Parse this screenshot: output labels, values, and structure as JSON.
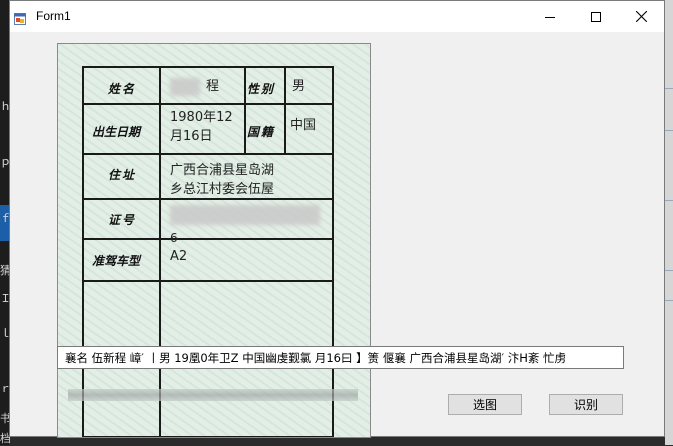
{
  "window": {
    "title": "Form1"
  },
  "id_card": {
    "labels": {
      "name": "姓名",
      "gender": "性别",
      "birth_date": "出生日期",
      "nationality": "国籍",
      "address": "住址",
      "id_number": "证号",
      "vehicle_class": "准驾车型"
    },
    "values": {
      "name_visible_part": "程",
      "gender": "男",
      "birth_date_line1": "1980年12",
      "birth_date_line2": "月16日",
      "nationality": "中国",
      "address_line1": "广西合浦县星岛湖",
      "address_line2": "乡总江村委会伍屋",
      "id_number_tail": "6",
      "vehicle_class": "A2"
    }
  },
  "ocr_result": {
    "value": "襄名 伍新程 嶂′ 丨男 19凰0年卫Z 中国幽虔觐氯 月16曰 】箦   偃襄 广西合浦县星岛湖′ 汴H紊 忙虏"
  },
  "buttons": {
    "select_image": "选图",
    "recognize": "识别"
  },
  "desktop_edge": {
    "left_chars": [
      "ｈ",
      "ｐ",
      "ｆ",
      "猜",
      "Ｉ",
      "ｌ",
      "ｒ",
      "书",
      "档案"
    ]
  },
  "colors": {
    "accent_blue": "#1c5fa8",
    "button_face": "#e1e1e1"
  }
}
